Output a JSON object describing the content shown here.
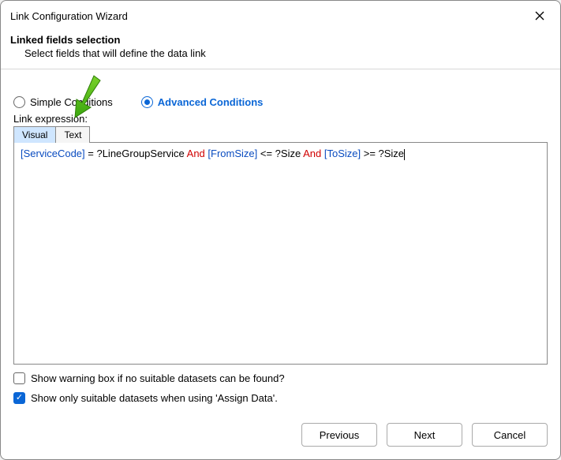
{
  "titlebar": {
    "title": "Link Configuration Wizard"
  },
  "header": {
    "title": "Linked fields selection",
    "subtitle": "Select fields that will define the data link"
  },
  "conditions": {
    "simple_label": "Simple Conditions",
    "advanced_label": "Advanced Conditions",
    "expression_label": "Link expression:"
  },
  "tabs": {
    "visual": "Visual",
    "text": "Text"
  },
  "expression": {
    "tokens": [
      {
        "type": "field",
        "text": "[ServiceCode]"
      },
      {
        "type": "plain",
        "text": " = ?LineGroupService  "
      },
      {
        "type": "keyword",
        "text": "And"
      },
      {
        "type": "plain",
        "text": " "
      },
      {
        "type": "field",
        "text": "[FromSize]"
      },
      {
        "type": "plain",
        "text": " <= ?Size "
      },
      {
        "type": "keyword",
        "text": "And"
      },
      {
        "type": "plain",
        "text": " "
      },
      {
        "type": "field",
        "text": "[ToSize]"
      },
      {
        "type": "plain",
        "text": " >= ?Size"
      }
    ]
  },
  "checks": {
    "warn_label": "Show warning box if no suitable datasets can be found?",
    "suitable_label": "Show only suitable datasets when using 'Assign Data'."
  },
  "footer": {
    "prev": "Previous",
    "next": "Next",
    "cancel": "Cancel"
  }
}
